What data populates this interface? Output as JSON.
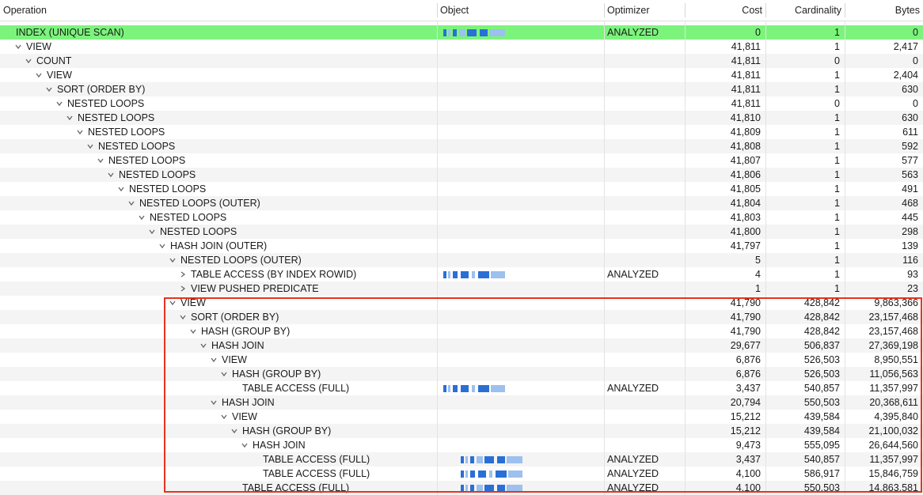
{
  "columns": {
    "operation": "Operation",
    "object": "Object",
    "optimizer": "Optimizer",
    "cost": "Cost",
    "cardinality": "Cardinality",
    "bytes": "Bytes"
  },
  "colors": {
    "highlight_row": "#7cf47c",
    "selection_box": "#e8321e",
    "redacted_object": "#2a6fd6"
  },
  "rows": [
    {
      "op": "INDEX (UNIQUE SCAN)",
      "depth": 0,
      "exp": "none",
      "obj": true,
      "optimizer": "ANALYZED",
      "cost": "0",
      "card": "1",
      "bytes": "0",
      "hl": true
    },
    {
      "op": "VIEW",
      "depth": 1,
      "exp": "open",
      "obj": false,
      "optimizer": "",
      "cost": "41,811",
      "card": "1",
      "bytes": "2,417"
    },
    {
      "op": "COUNT",
      "depth": 2,
      "exp": "open",
      "obj": false,
      "optimizer": "",
      "cost": "41,811",
      "card": "0",
      "bytes": "0"
    },
    {
      "op": "VIEW",
      "depth": 3,
      "exp": "open",
      "obj": false,
      "optimizer": "",
      "cost": "41,811",
      "card": "1",
      "bytes": "2,404"
    },
    {
      "op": "SORT (ORDER BY)",
      "depth": 4,
      "exp": "open",
      "obj": false,
      "optimizer": "",
      "cost": "41,811",
      "card": "1",
      "bytes": "630"
    },
    {
      "op": "NESTED LOOPS",
      "depth": 5,
      "exp": "open",
      "obj": false,
      "optimizer": "",
      "cost": "41,811",
      "card": "0",
      "bytes": "0"
    },
    {
      "op": "NESTED LOOPS",
      "depth": 6,
      "exp": "open",
      "obj": false,
      "optimizer": "",
      "cost": "41,810",
      "card": "1",
      "bytes": "630"
    },
    {
      "op": "NESTED LOOPS",
      "depth": 7,
      "exp": "open",
      "obj": false,
      "optimizer": "",
      "cost": "41,809",
      "card": "1",
      "bytes": "611"
    },
    {
      "op": "NESTED LOOPS",
      "depth": 8,
      "exp": "open",
      "obj": false,
      "optimizer": "",
      "cost": "41,808",
      "card": "1",
      "bytes": "592"
    },
    {
      "op": "NESTED LOOPS",
      "depth": 9,
      "exp": "open",
      "obj": false,
      "optimizer": "",
      "cost": "41,807",
      "card": "1",
      "bytes": "577"
    },
    {
      "op": "NESTED LOOPS",
      "depth": 10,
      "exp": "open",
      "obj": false,
      "optimizer": "",
      "cost": "41,806",
      "card": "1",
      "bytes": "563"
    },
    {
      "op": "NESTED LOOPS",
      "depth": 11,
      "exp": "open",
      "obj": false,
      "optimizer": "",
      "cost": "41,805",
      "card": "1",
      "bytes": "491"
    },
    {
      "op": "NESTED LOOPS (OUTER)",
      "depth": 12,
      "exp": "open",
      "obj": false,
      "optimizer": "",
      "cost": "41,804",
      "card": "1",
      "bytes": "468"
    },
    {
      "op": "NESTED LOOPS",
      "depth": 13,
      "exp": "open",
      "obj": false,
      "optimizer": "",
      "cost": "41,803",
      "card": "1",
      "bytes": "445"
    },
    {
      "op": "NESTED LOOPS",
      "depth": 14,
      "exp": "open",
      "obj": false,
      "optimizer": "",
      "cost": "41,800",
      "card": "1",
      "bytes": "298"
    },
    {
      "op": "HASH JOIN (OUTER)",
      "depth": 15,
      "exp": "open",
      "obj": false,
      "optimizer": "",
      "cost": "41,797",
      "card": "1",
      "bytes": "139"
    },
    {
      "op": "NESTED LOOPS (OUTER)",
      "depth": 16,
      "exp": "open",
      "obj": false,
      "optimizer": "",
      "cost": "5",
      "card": "1",
      "bytes": "116"
    },
    {
      "op": "TABLE ACCESS (BY INDEX ROWID)",
      "depth": 17,
      "exp": "closed",
      "obj": true,
      "optimizer": "ANALYZED",
      "cost": "4",
      "card": "1",
      "bytes": "93"
    },
    {
      "op": "VIEW PUSHED PREDICATE",
      "depth": 17,
      "exp": "closed",
      "obj": false,
      "optimizer": "",
      "cost": "1",
      "card": "1",
      "bytes": "23"
    },
    {
      "op": "VIEW",
      "depth": 16,
      "exp": "open",
      "obj": false,
      "optimizer": "",
      "cost": "41,790",
      "card": "428,842",
      "bytes": "9,863,366"
    },
    {
      "op": "SORT (ORDER BY)",
      "depth": 17,
      "exp": "open",
      "obj": false,
      "optimizer": "",
      "cost": "41,790",
      "card": "428,842",
      "bytes": "23,157,468"
    },
    {
      "op": "HASH (GROUP BY)",
      "depth": 18,
      "exp": "open",
      "obj": false,
      "optimizer": "",
      "cost": "41,790",
      "card": "428,842",
      "bytes": "23,157,468"
    },
    {
      "op": "HASH JOIN",
      "depth": 19,
      "exp": "open",
      "obj": false,
      "optimizer": "",
      "cost": "29,677",
      "card": "506,837",
      "bytes": "27,369,198"
    },
    {
      "op": "VIEW",
      "depth": 20,
      "exp": "open",
      "obj": false,
      "optimizer": "",
      "cost": "6,876",
      "card": "526,503",
      "bytes": "8,950,551"
    },
    {
      "op": "HASH (GROUP BY)",
      "depth": 21,
      "exp": "open",
      "obj": false,
      "optimizer": "",
      "cost": "6,876",
      "card": "526,503",
      "bytes": "11,056,563"
    },
    {
      "op": "TABLE ACCESS (FULL)",
      "depth": 22,
      "exp": "none",
      "obj": true,
      "optimizer": "ANALYZED",
      "cost": "3,437",
      "card": "540,857",
      "bytes": "11,357,997"
    },
    {
      "op": "HASH JOIN",
      "depth": 20,
      "exp": "open",
      "obj": false,
      "optimizer": "",
      "cost": "20,794",
      "card": "550,503",
      "bytes": "20,368,611"
    },
    {
      "op": "VIEW",
      "depth": 21,
      "exp": "open",
      "obj": false,
      "optimizer": "",
      "cost": "15,212",
      "card": "439,584",
      "bytes": "4,395,840"
    },
    {
      "op": "HASH (GROUP BY)",
      "depth": 22,
      "exp": "open",
      "obj": false,
      "optimizer": "",
      "cost": "15,212",
      "card": "439,584",
      "bytes": "21,100,032"
    },
    {
      "op": "HASH JOIN",
      "depth": 23,
      "exp": "open",
      "obj": false,
      "optimizer": "",
      "cost": "9,473",
      "card": "555,095",
      "bytes": "26,644,560"
    },
    {
      "op": "TABLE ACCESS (FULL)",
      "depth": 24,
      "exp": "none",
      "obj": true,
      "optimizer": "ANALYZED",
      "cost": "3,437",
      "card": "540,857",
      "bytes": "11,357,997"
    },
    {
      "op": "TABLE ACCESS (FULL)",
      "depth": 24,
      "exp": "none",
      "obj": true,
      "optimizer": "ANALYZED",
      "cost": "4,100",
      "card": "586,917",
      "bytes": "15,846,759"
    },
    {
      "op": "TABLE ACCESS (FULL)",
      "depth": 22,
      "exp": "none",
      "obj": true,
      "optimizer": "ANALYZED",
      "cost": "4,100",
      "card": "550,503",
      "bytes": "14,863,581"
    }
  ]
}
